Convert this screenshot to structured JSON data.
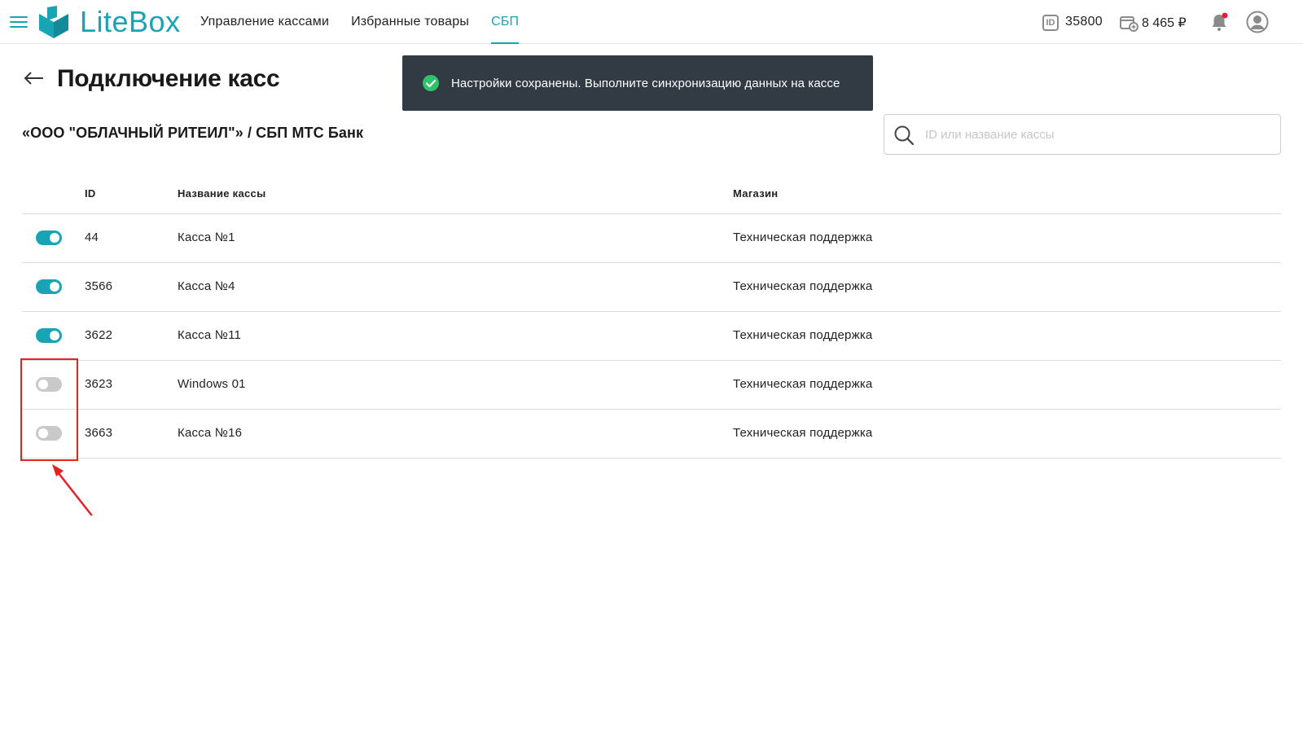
{
  "header": {
    "logo_text": "LiteBox",
    "nav": [
      {
        "label": "Управление кассами",
        "active": false
      },
      {
        "label": "Избранные товары",
        "active": false
      },
      {
        "label": "СБП",
        "active": true
      }
    ],
    "id_badge": "ID",
    "account_id": "35800",
    "balance": "8 465 ₽",
    "accent_color": "#19a4b5",
    "notification_dot_color": "#e52235"
  },
  "page": {
    "title": "Подключение касс",
    "org_line": "«ООО \"ОБЛАЧНЫЙ РИТЕИЛ\"» / СБП МТС Банк"
  },
  "toast": {
    "message": "Настройки сохранены. Выполните синхронизацию данных на кассе",
    "background": "#323b44",
    "icon": "check-circle-icon"
  },
  "search": {
    "placeholder": "ID или название кассы",
    "value": ""
  },
  "table": {
    "columns": {
      "id": "ID",
      "name": "Название кассы",
      "shop": "Магазин"
    },
    "rows": [
      {
        "enabled": true,
        "id": "44",
        "name": "Касса №1",
        "shop": "Техническая поддержка"
      },
      {
        "enabled": true,
        "id": "3566",
        "name": "Касса №4",
        "shop": "Техническая поддержка"
      },
      {
        "enabled": true,
        "id": "3622",
        "name": "Касса №11",
        "shop": "Техническая поддержка"
      },
      {
        "enabled": false,
        "id": "3623",
        "name": "Windows 01",
        "shop": "Техническая поддержка"
      },
      {
        "enabled": false,
        "id": "3663",
        "name": "Касса №16",
        "shop": "Техническая поддержка"
      }
    ]
  },
  "annotation": {
    "color": "#e52222"
  }
}
